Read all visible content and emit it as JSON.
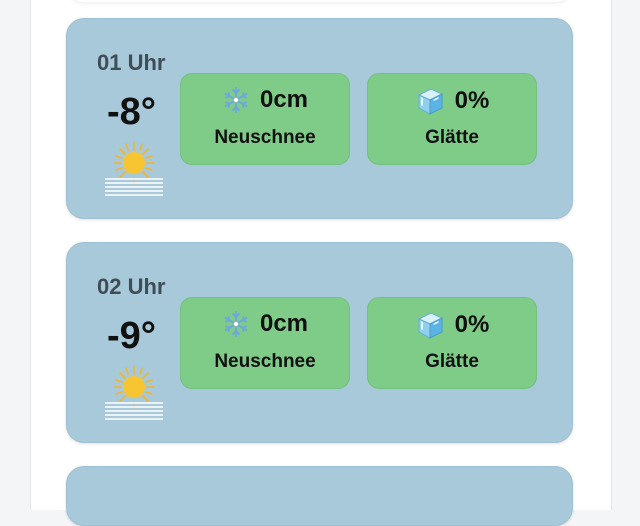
{
  "hours": [
    {
      "time": "01 Uhr",
      "temperature": "-8°",
      "weather_icon": "sunny-frost-icon",
      "snow": {
        "icon": "snowflake-icon",
        "value": "0cm",
        "label": "Neuschnee"
      },
      "ice": {
        "icon": "ice-cube-icon",
        "value": "0%",
        "label": "Glätte"
      }
    },
    {
      "time": "02 Uhr",
      "temperature": "-9°",
      "weather_icon": "sunny-frost-icon",
      "snow": {
        "icon": "snowflake-icon",
        "value": "0cm",
        "label": "Neuschnee"
      },
      "ice": {
        "icon": "ice-cube-icon",
        "value": "0%",
        "label": "Glätte"
      }
    }
  ],
  "colors": {
    "card_background": "#a8c9da",
    "tile_background": "#7fcc89",
    "page_background": "#ffffff"
  }
}
